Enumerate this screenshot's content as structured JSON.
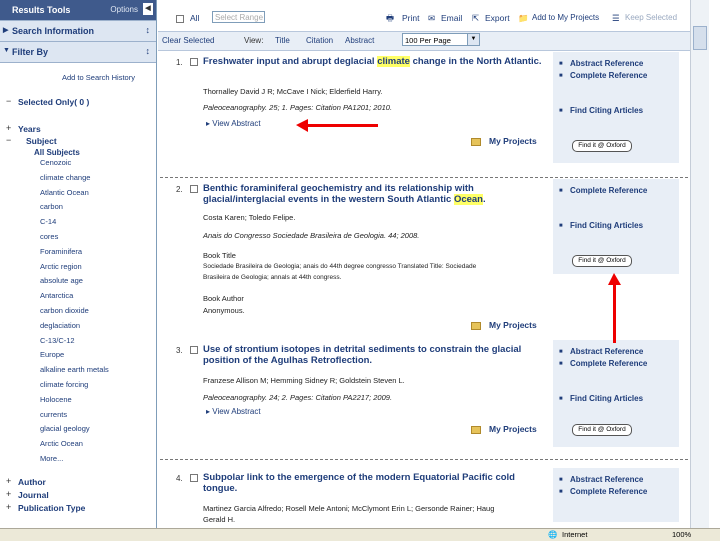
{
  "sidebar": {
    "results_tools": "Results Tools",
    "options": "Options",
    "search_information": "Search Information",
    "filter_by": "Filter By",
    "add_to_search_history": "Add to Search History",
    "selected_only": "Selected Only( 0 )",
    "years": "Years",
    "subject": "Subject",
    "all_subjects": "All Subjects",
    "subjects": [
      "Cenozoic",
      "climate change",
      "Atlantic Ocean",
      "carbon",
      "C-14",
      "cores",
      "Foraminifera",
      "Arctic region",
      "absolute age",
      "Antarctica",
      "carbon dioxide",
      "deglaciation",
      "C-13/C-12",
      "Europe",
      "alkaline earth metals",
      "climate forcing",
      "Holocene",
      "currents",
      "glacial geology",
      "Arctic Ocean",
      "More..."
    ],
    "author": "Author",
    "journal": "Journal",
    "publication_type": "Publication Type"
  },
  "toolbar": {
    "all_label": "All",
    "select_range_placeholder": "Select Range",
    "print": "Print",
    "email": "Email",
    "export": "Export",
    "add_to_projects": "Add to My Projects",
    "keep_selected": "Keep Selected"
  },
  "viewbar": {
    "clear_selected": "Clear Selected",
    "view_label": "View:",
    "title": "Title",
    "citation": "Citation",
    "abstract": "Abstract",
    "per_page": "100 Per Page"
  },
  "results": [
    {
      "num": "1.",
      "title_pre": "Freshwater input and abrupt deglacial ",
      "title_hl": "climate",
      "title_post": " change in the North Atlantic.",
      "authors": "Thornalley David J R; McCave I Nick; Elderfield Harry.",
      "citation": "Paleoceanography. 25; 1. Pages: Citation PA1201; 2010.",
      "view_abstract": "View Abstract",
      "links": [
        "Abstract Reference",
        "Complete Reference",
        "Find Citing Articles"
      ]
    },
    {
      "num": "2.",
      "title_pre": "Benthic foraminiferal geochemistry and its relationship with glacial/interglacial events in the western South Atlantic ",
      "title_hl": "Ocean",
      "title_post": ".",
      "authors": "Costa Karen; Toledo Felipe.",
      "citation": "Anais do Congresso Sociedade Brasileira de Geologia. 44; 2008.",
      "book_title_label": "Book Title",
      "book_title": "Sociedade Brasileira de Geologia; anais do 44th degree congresso Translated Title: Sociedade",
      "book_title2": "Brasileira de Geologia; annals at 44th congress.",
      "book_author_label": "Book Author",
      "book_author": "Anonymous.",
      "links": [
        "Complete Reference",
        "Find Citing Articles"
      ]
    },
    {
      "num": "3.",
      "title_pre": "Use of strontium isotopes in detrital sediments to constrain the glacial position of the Agulhas Retroflection.",
      "title_hl": "",
      "title_post": "",
      "authors": "Franzese Allison M; Hemming Sidney R; Goldstein Steven L.",
      "citation": "Paleoceanography. 24; 2. Pages: Citation PA2217; 2009.",
      "view_abstract": "View Abstract",
      "links": [
        "Abstract Reference",
        "Complete Reference",
        "Find Citing Articles"
      ]
    },
    {
      "num": "4.",
      "title_pre": "Subpolar link to the emergence of the modern Equatorial Pacific cold tongue.",
      "title_hl": "",
      "title_post": "",
      "authors": "Martinez Garcia Alfredo; Rosell Mele Antoni; McClymont Erin L; Gersonde Rainer; Haug",
      "authors2": "Gerald H.",
      "links": [
        "Abstract Reference",
        "Complete Reference"
      ]
    }
  ],
  "my_projects": "My Projects",
  "find_it": "Find it @ Oxford",
  "status": {
    "zone": "Internet",
    "zoom": "100%"
  }
}
